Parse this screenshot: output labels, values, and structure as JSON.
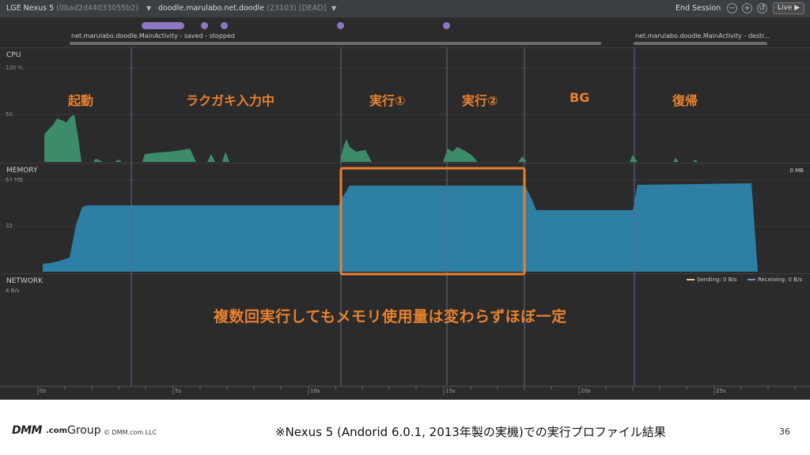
{
  "toolbar": {
    "device": "LGE Nexus 5",
    "serial": "(0bad2d44033055b2)",
    "process": "doodle.marulabo.net.doodle",
    "process_state": "(23103) [DEAD]",
    "end_session": "End Session",
    "live": "Live"
  },
  "events": {
    "activity_left": "net.marulabo.doodle.MainActivity - saved - stopped",
    "activity_right": "net.marulabo.doodle.MainActivity - destr..."
  },
  "cpu": {
    "title": "CPU",
    "tick_top": "100 %",
    "tick_mid": "50"
  },
  "memory": {
    "title": "MEMORY",
    "tick_top": "64 MB",
    "tick_mid": "32",
    "right": "0 MB"
  },
  "network": {
    "title": "NETWORK",
    "tick_top": "4 B/s",
    "legend_sending": "Sending: 0 B/s",
    "legend_receiving": "Receiving: 0 B/s",
    "sending_color": "#f2c98a",
    "receiving_color": "#6d8fd6"
  },
  "timeline": {
    "ticks": [
      "0s",
      "5s",
      "10s",
      "15s",
      "20s",
      "25s"
    ]
  },
  "phases": {
    "startup": "起動",
    "doodle": "ラクガキ入力中",
    "run1": "実行①",
    "run2": "実行②",
    "bg": "BG",
    "resume": "復帰"
  },
  "note": "複数回実行してもメモリ使用量は変わらずほぼ一定",
  "footer": {
    "brand_dmm": "DMM",
    "brand_com": ".com",
    "brand_group": "Group",
    "copyright": "© DMM.com LLC",
    "caption": "※Nexus 5 (Andorid 6.0.1, 2013年製の実機)での実行プロファイル結果",
    "page": "36"
  },
  "colors": {
    "accent": "#e8812f",
    "cpu": "#3c8c6a",
    "memory": "#2e7fa4",
    "event": "#8e77c2"
  }
}
